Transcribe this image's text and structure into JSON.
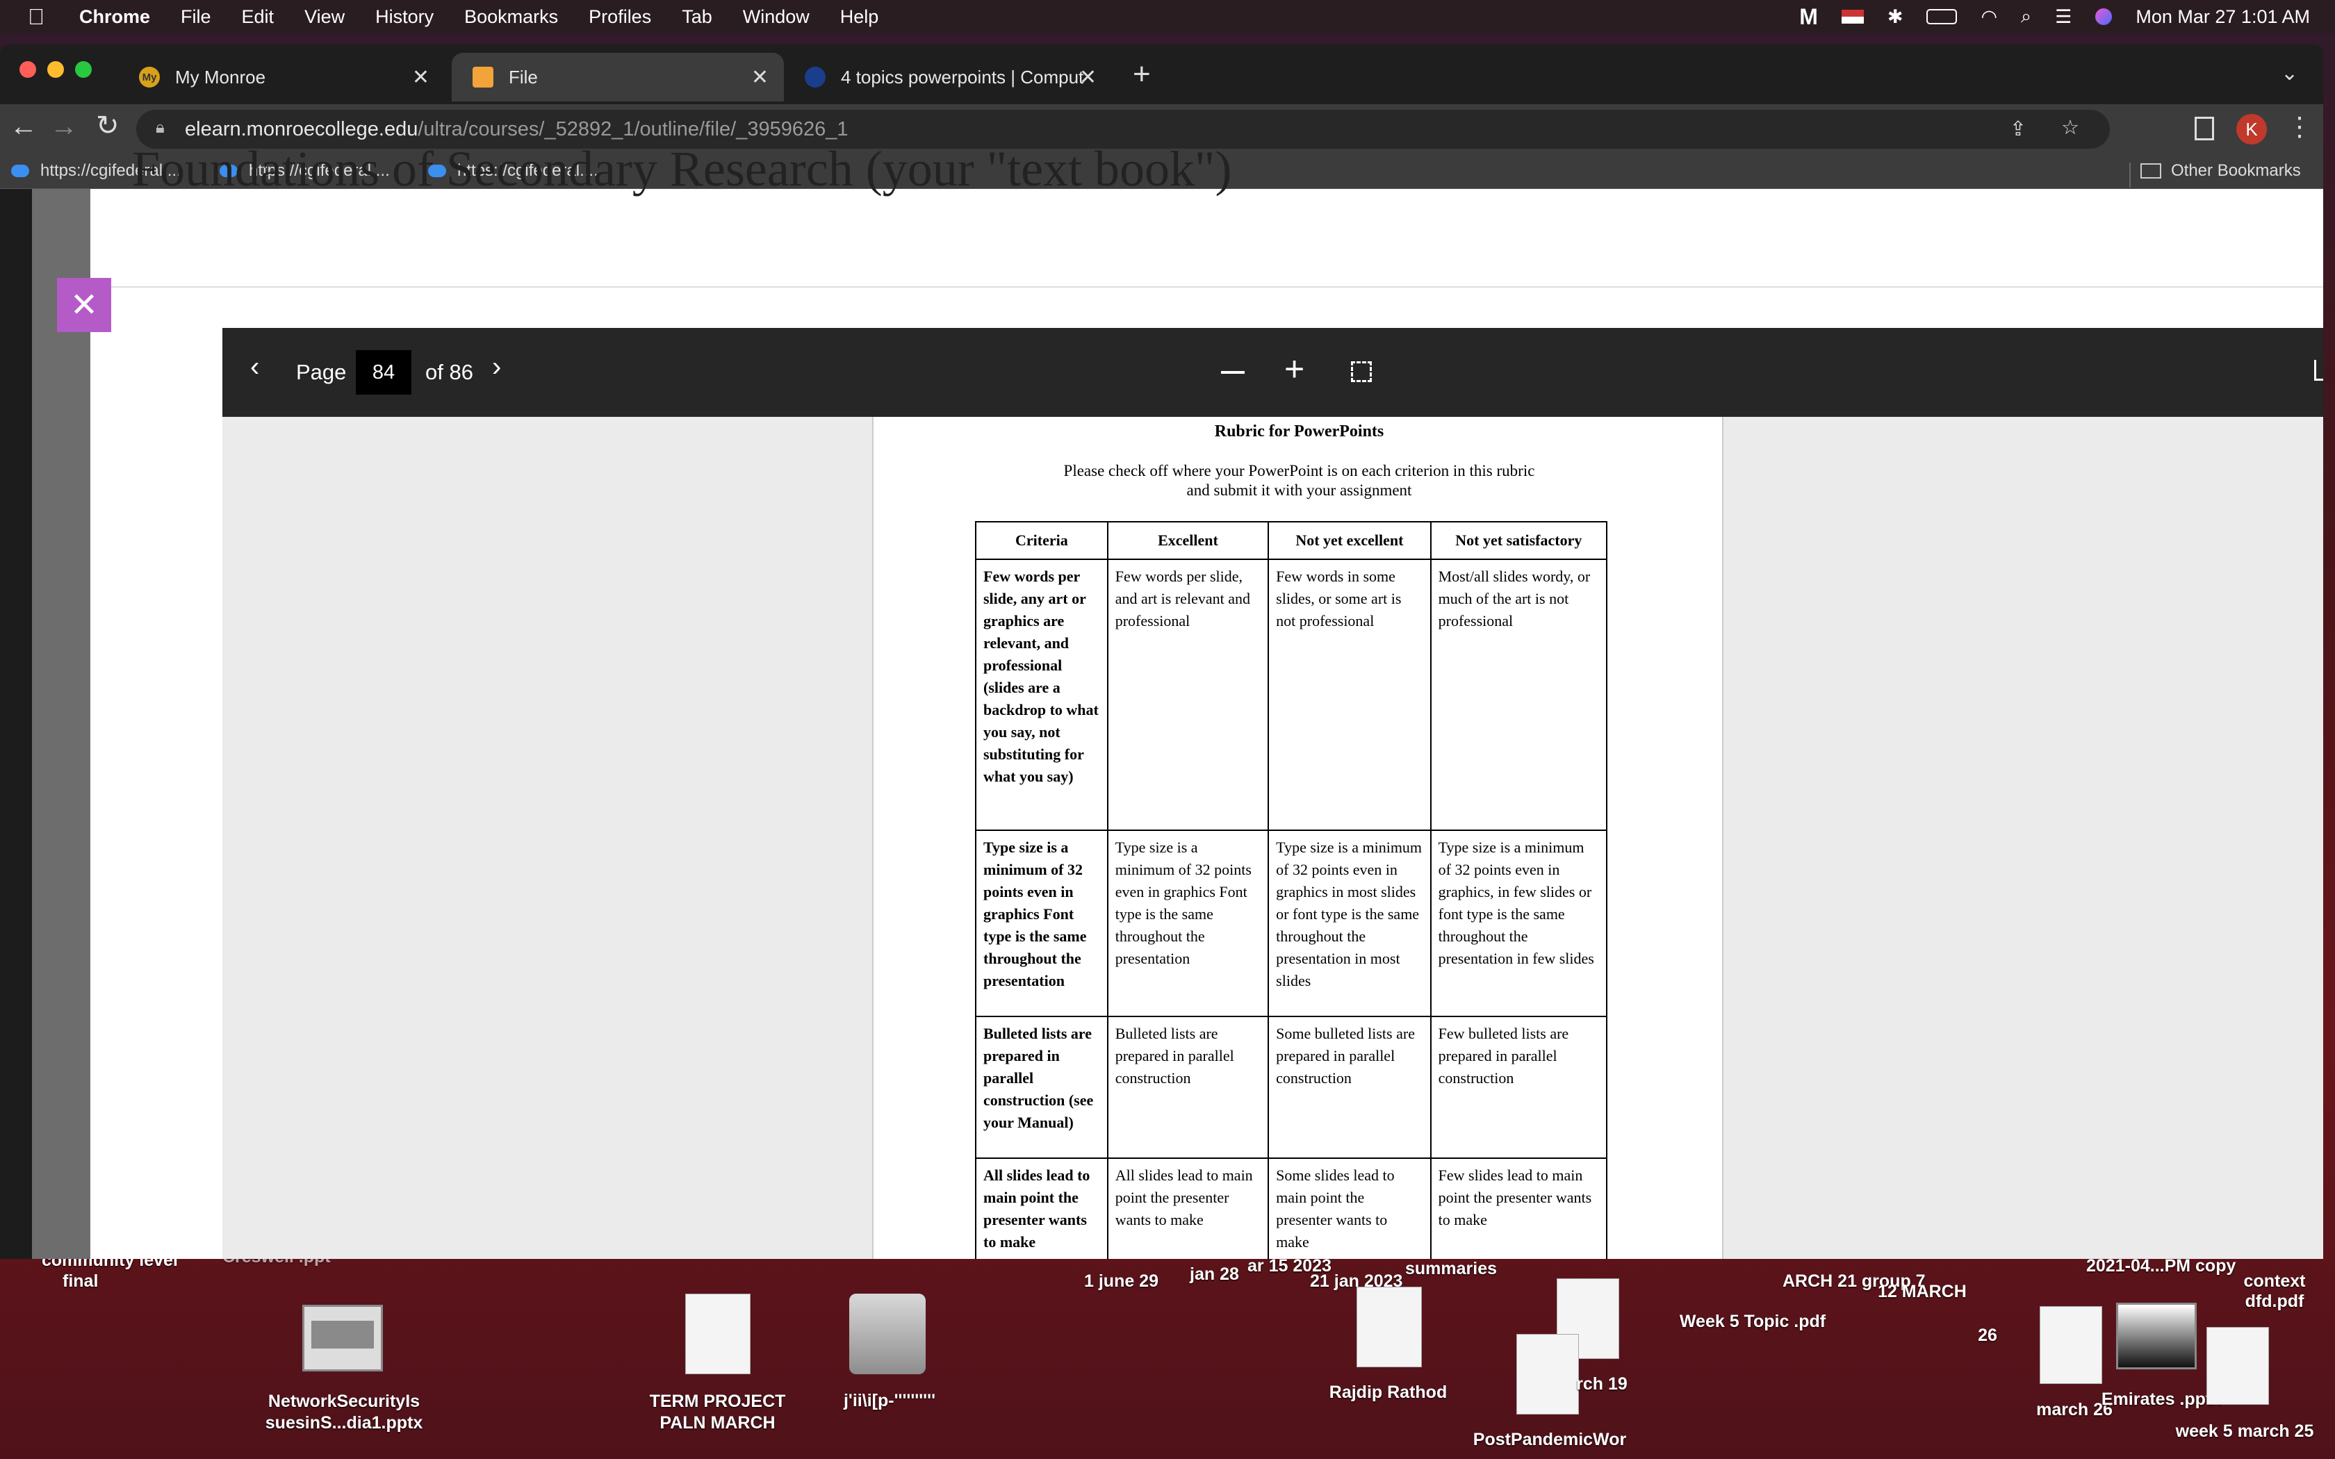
{
  "menubar": {
    "app": "Chrome",
    "items": [
      "File",
      "Edit",
      "View",
      "History",
      "Bookmarks",
      "Profiles",
      "Tab",
      "Window",
      "Help"
    ],
    "datetime": "Mon Mar 27  1:01 AM"
  },
  "tabs": [
    {
      "title": "My Monroe",
      "favicon": "My"
    },
    {
      "title": "File",
      "favicon": ""
    },
    {
      "title": "4 topics powerpoints | Comput",
      "favicon": ""
    }
  ],
  "address": {
    "host": "elearn.monroecollege.edu",
    "path": "/ultra/courses/_52892_1/outline/file/_3959626_1"
  },
  "bookmarks": [
    "https://cgifederal....",
    "https://cgifederal....",
    "https://cgifederal...."
  ],
  "other_bookmarks": "Other Bookmarks",
  "profile_initial": "K",
  "modal": {
    "title": "Foundations of Secondary Research (your \"text book\")"
  },
  "viewer": {
    "page_label": "Page",
    "page": "84",
    "of_total": "of 86"
  },
  "document": {
    "title": "Rubric for PowerPoints",
    "subtitle1": "Please check off where your PowerPoint is on each criterion in this rubric",
    "subtitle2": "and submit it with your assignment",
    "headers": [
      "Criteria",
      "Excellent",
      "Not yet excellent",
      "Not yet satisfactory"
    ],
    "rows": [
      [
        "Few words per  slide, any art or graphics are relevant, and professional (slides are a backdrop to what you say, not substituting for what you say)",
        "Few words per slide, and art is relevant and professional",
        "Few words in some slides, or some art is not professional",
        "Most/all slides wordy, or much of the art is not professional"
      ],
      [
        "Type size is a minimum of 32 points even in graphics Font type is the same throughout the presentation",
        "Type size is a minimum of 32 points even in graphics Font type is the same throughout the presentation",
        "Type size is a minimum of 32 points even in graphics in most slides or font type is the same throughout the presentation in most slides",
        "Type size is  a minimum of 32 points even in graphics, in few slides or font type is the same throughout the presentation in few slides"
      ],
      [
        "Bulleted lists are prepared in parallel construction (see your Manual)",
        "Bulleted lists are prepared in parallel construction",
        "Some bulleted lists are prepared in parallel construction",
        "Few bulleted lists are prepared in parallel construction"
      ],
      [
        "All slides lead to main point the presenter wants to make",
        "All slides lead to main point the presenter wants to make",
        "Some slides lead to main point the presenter wants to make",
        "Few slides lead to main point the presenter wants to make"
      ]
    ]
  },
  "desktop": {
    "partial_labels": [
      "community level",
      "final",
      "Creswell .ppt",
      "1 june 29",
      "jan 28",
      "ar 15 2023",
      "21 jan 2023",
      "summaries",
      "ARCH 21 group 7",
      "12 MARCH",
      "2021-04...PM copy",
      "context dfd.pdf"
    ],
    "icons": [
      {
        "label1": "NetworkSecurityIs",
        "label2": "suesinS...dia1.pptx"
      },
      {
        "label1": "TERM PROJECT",
        "label2": "PALN MARCH"
      },
      {
        "label1": "j'ii\\i[p-''''''''''",
        "label2": ""
      },
      {
        "label1": "Rajdip Rathod",
        "label2": ""
      },
      {
        "label1": "PostPandemicWor",
        "label2": ""
      },
      {
        "label1": "rch 19",
        "label2": ""
      },
      {
        "label1": "Week 5 Topic .pdf",
        "label2": ""
      },
      {
        "label1": "26",
        "label2": ""
      },
      {
        "label1": "march 26",
        "label2": ""
      },
      {
        "label1": "Emirates .pptx",
        "label2": ""
      },
      {
        "label1": "week 5 march 25",
        "label2": ""
      }
    ]
  }
}
